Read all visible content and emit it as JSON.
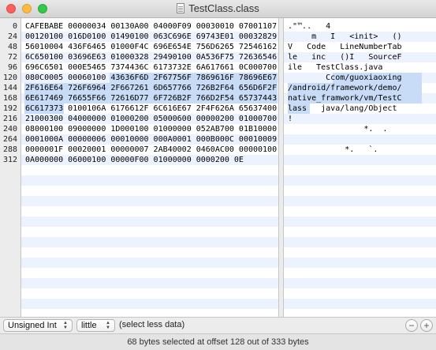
{
  "window": {
    "title": "TestClass.class"
  },
  "hex_view": {
    "offsets": [
      "0",
      "24",
      "48",
      "72",
      "96",
      "120",
      "144",
      "168",
      "192",
      "216",
      "240",
      "264",
      "288",
      "312"
    ],
    "hex_rows": [
      "CAFEBABE 00000034 00130A00 04000F09 00030010 07001107",
      "00120100 016D0100 01490100 063C696E 69743E01 00032829",
      "56010004 436F6465 01000F4C 696E654E 756D6265 72546162",
      "6C650100 03696E63 01000328 29490100 0A536F75 72636546",
      "696C6501 000E5465 7374436C 6173732E 6A617661 0C000700",
      "080C0005 00060100 43636F6D 2F67756F 7869616F 78696E67",
      "2F616E64 726F6964 2F667261 6D657766 726B2F64 656D6F2F",
      "6E617469 76655F66 72616D77 6F726B2F 766D2F54 65737443",
      "6C617373 0100106A 6176612F 6C616E67 2F4F626A 65637400",
      "21000300 04000000 01000200 05000600 00000200 01000700",
      "08000100 09000000 1D000100 01000000 052AB700 01B10000",
      "0001000A 00000006 00010000 000A0001 000B000C 00010009",
      "0000001F 00020001 00000007 2AB40002 0460AC00 00000100",
      "0A000000 06000100 00000F00 01000000 0000200 0E"
    ],
    "ascii_rows": [
      ".\"™..   4",
      "     m   I   <init>   ()",
      "V   Code   LineNumberTab",
      "le   inc   ()I   SourceF",
      "ile   TestClass.java",
      "        Ccom/guoxiaoxing",
      "/android/framework/demo/",
      "native_framwork/vm/TestC",
      "lass   java/lang/Object",
      "!",
      "                *.  .",
      "",
      "            *.   `.",
      ""
    ]
  },
  "bottom_bar": {
    "type_select": "Unsigned Int",
    "endian_select": "little",
    "select_less_label": "(select less data)",
    "minus_label": "−",
    "plus_label": "+"
  },
  "status_bar": {
    "text": "68 bytes selected at offset 128 out of 333 bytes"
  },
  "selection": {
    "offset": 128,
    "length": 68,
    "total_bytes": 333,
    "bytes_per_row": 24
  },
  "colors": {
    "selection": "#c8dcf8",
    "stripe": "#edf3fe"
  }
}
